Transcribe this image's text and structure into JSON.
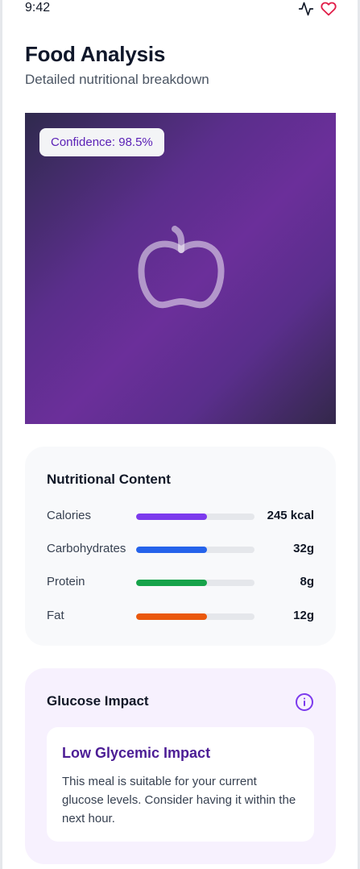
{
  "status_bar": {
    "time": "9:42"
  },
  "header": {
    "title": "Food Analysis",
    "subtitle": "Detailed nutritional breakdown"
  },
  "image": {
    "confidence": "Confidence: 98.5%",
    "icon": "apple-icon"
  },
  "nutrition": {
    "title": "Nutritional Content",
    "rows": [
      {
        "label": "Calories",
        "value": "245 kcal",
        "fill_pct": 60,
        "color": "#7c3aed"
      },
      {
        "label": "Carbohydrates",
        "value": "32g",
        "fill_pct": 60,
        "color": "#2563eb"
      },
      {
        "label": "Protein",
        "value": "8g",
        "fill_pct": 60,
        "color": "#16a34a"
      },
      {
        "label": "Fat",
        "value": "12g",
        "fill_pct": 60,
        "color": "#ea580c"
      }
    ]
  },
  "glucose": {
    "title": "Glucose Impact",
    "impact_title": "Low Glycemic Impact",
    "impact_text": "This meal is suitable for your current glucose levels. Consider having it within the next hour."
  },
  "colors": {
    "accent": "#7c3aed",
    "heart": "#e11d48"
  }
}
